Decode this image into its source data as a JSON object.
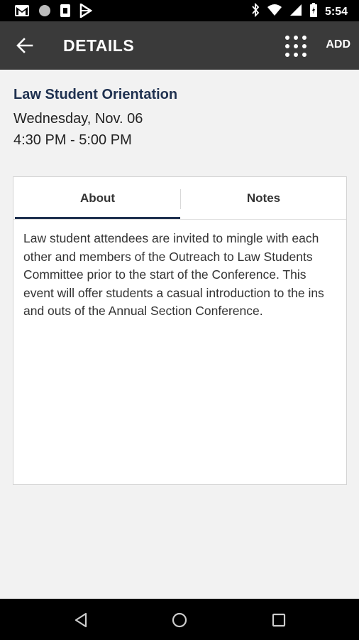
{
  "status_bar": {
    "icons": [
      "gmail-icon",
      "circle-icon",
      "sim-icon",
      "play-store-icon",
      "bluetooth-icon",
      "wifi-icon",
      "signal-icon",
      "battery-icon"
    ],
    "time": "5:54"
  },
  "app_bar": {
    "title": "DETAILS",
    "add_label": "ADD"
  },
  "event": {
    "title": "Law Student Orientation",
    "date": "Wednesday, Nov. 06",
    "time": "4:30 PM - 5:00 PM"
  },
  "tabs": [
    {
      "label": "About",
      "active": true
    },
    {
      "label": "Notes",
      "active": false
    }
  ],
  "about": {
    "text": "Law student attendees are invited to mingle with each other and members of the Outreach to Law Students Committee prior to the start of the Conference. This event will offer students a casual introduction to the ins and outs of the Annual Section Conference."
  },
  "colors": {
    "app_bar": "#3a3a3a",
    "accent": "#1f3150",
    "background": "#f2f2f2"
  }
}
